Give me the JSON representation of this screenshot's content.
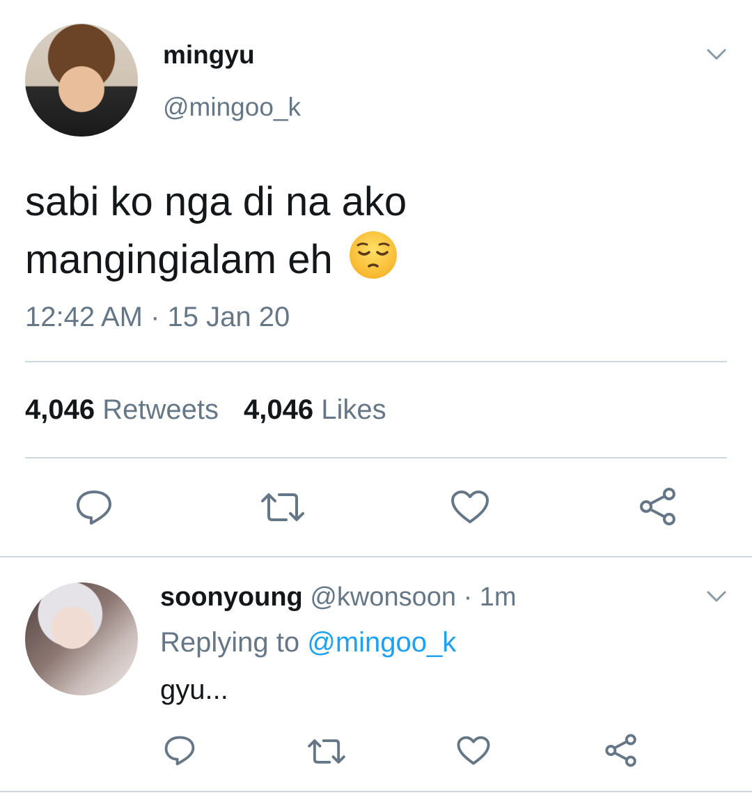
{
  "tweet": {
    "author_name": "mingyu",
    "author_handle": "@mingoo_k",
    "text_line1": "sabi ko nga di na ako",
    "text_line2": "mangingialam eh",
    "emoji": "pensive-face",
    "timestamp": "12:42 AM · 15 Jan 20",
    "retweets_count": "4,046",
    "retweets_label": "Retweets",
    "likes_count": "4,046",
    "likes_label": "Likes"
  },
  "reply": {
    "author_name": "soonyoung",
    "author_handle": "@kwonsoon",
    "separator": " · ",
    "time": "1m",
    "replying_label": "Replying to ",
    "replying_mention": "@mingoo_k",
    "text": "gyu..."
  },
  "icons": {
    "reply": "reply-icon",
    "retweet": "retweet-icon",
    "like": "heart-icon",
    "share": "share-icon",
    "menu": "chevron-down-icon"
  },
  "colors": {
    "text": "#14171a",
    "secondary": "#657786",
    "link": "#1da1f2",
    "divider": "#ccd6dd",
    "icon": "#657786"
  }
}
